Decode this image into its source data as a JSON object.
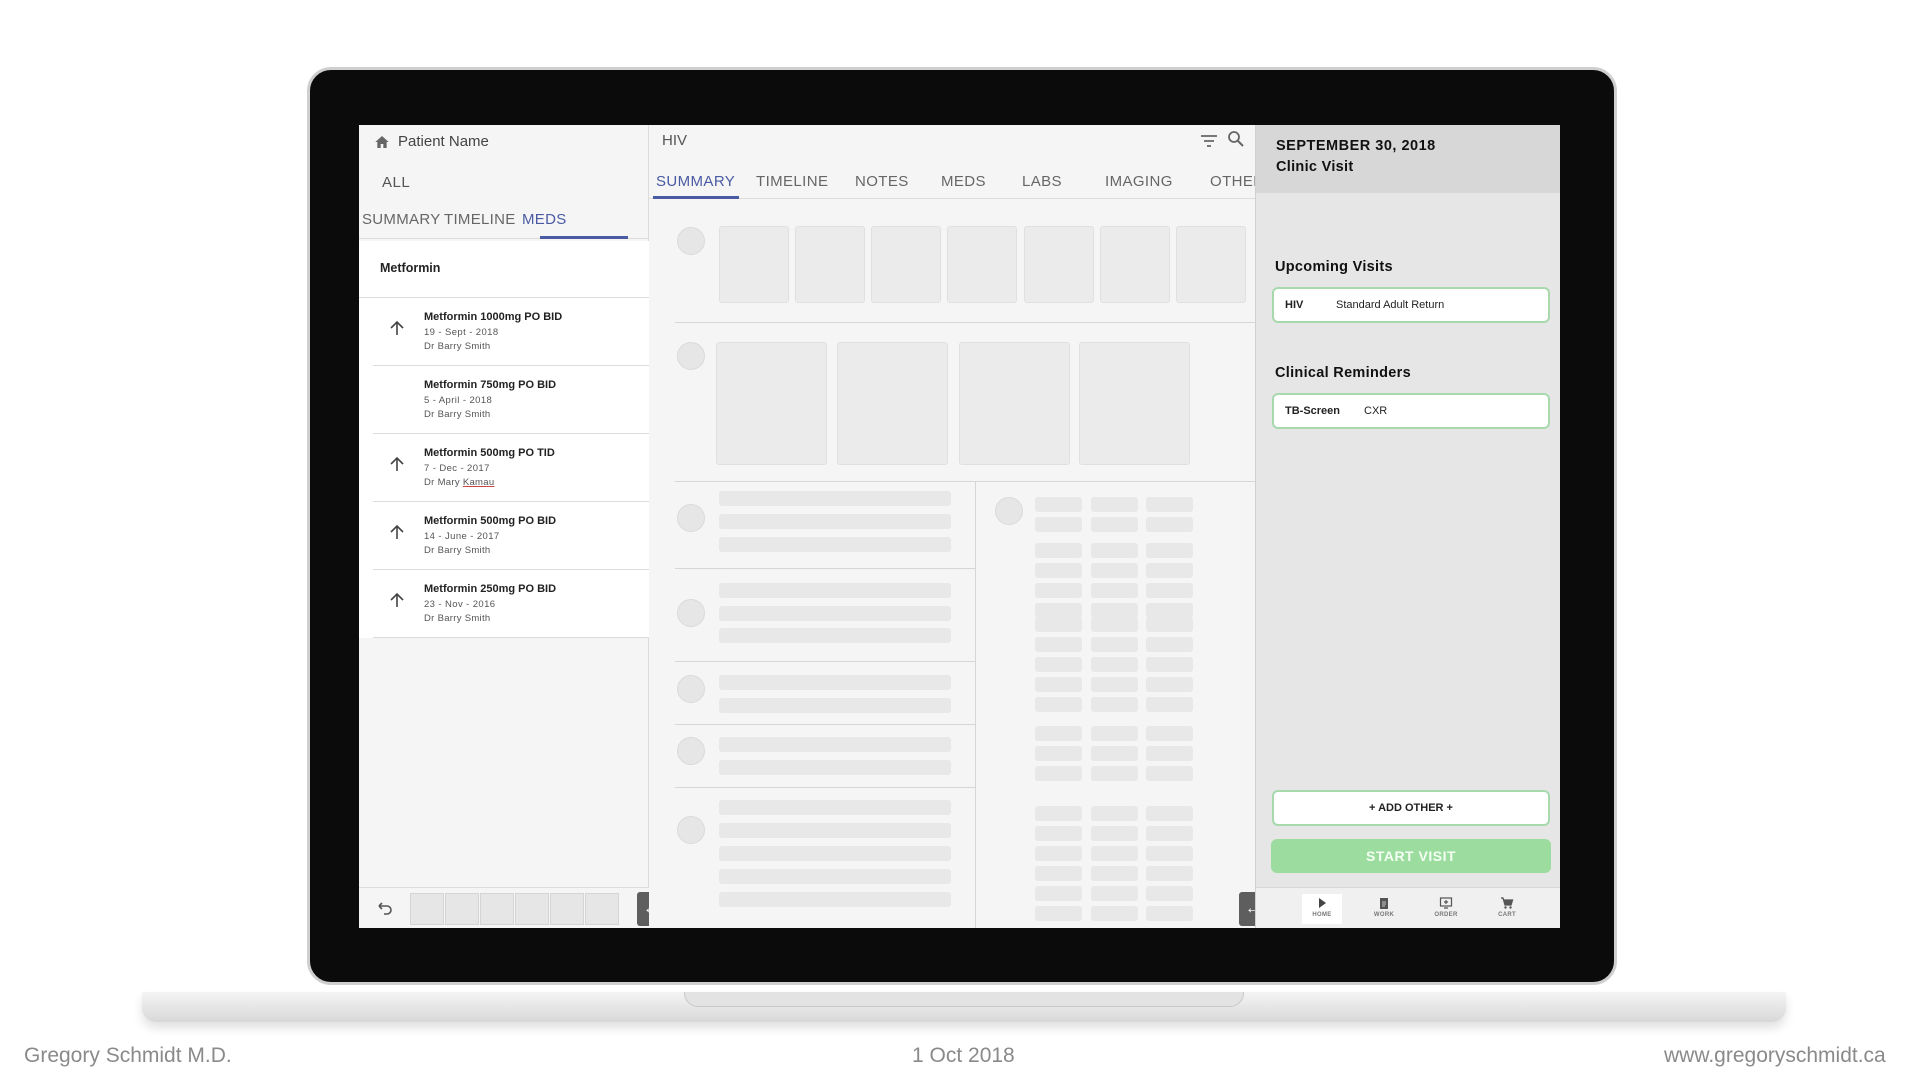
{
  "patient": {
    "name": "Patient Name",
    "filter": "ALL"
  },
  "left_tabs": [
    "SUMMARY",
    "TIMELINE",
    "MEDS"
  ],
  "med_group": "Metformin",
  "meds": [
    {
      "name": "Metformin 1000mg PO BID",
      "date": "19 - Sept - 2018",
      "doctor": "Dr Barry Smith",
      "arrow": true
    },
    {
      "name": "Metformin 750mg PO BID",
      "date": "5 - April - 2018",
      "doctor": "Dr Barry Smith",
      "arrow": false
    },
    {
      "name": "Metformin 500mg PO TID",
      "date": "7 - Dec - 2017",
      "doctor_prefix": "Dr Mary ",
      "doctor_surname": "Kamau",
      "arrow": true
    },
    {
      "name": "Metformin 500mg PO BID",
      "date": "14 - June - 2017",
      "doctor": "Dr Barry Smith",
      "arrow": true
    },
    {
      "name": "Metformin 250mg PO BID",
      "date": "23 - Nov - 2016",
      "doctor": "Dr Barry Smith",
      "arrow": true
    }
  ],
  "middle": {
    "title": "HIV",
    "tabs": [
      "SUMMARY",
      "TIMELINE",
      "NOTES",
      "MEDS",
      "LABS",
      "IMAGING",
      "OTHER"
    ]
  },
  "visit": {
    "date": "SEPTEMBER 30, 2018",
    "type": "Clinic Visit",
    "upcoming_title": "Upcoming Visits",
    "upcoming": {
      "tag": "HIV",
      "label": "Standard Adult Return"
    },
    "reminders_title": "Clinical Reminders",
    "reminder": {
      "tag": "TB-Screen",
      "label": "CXR"
    },
    "add_label": "+ ADD OTHER +",
    "start_label": "START VISIT"
  },
  "bottom_nav": [
    "HOME",
    "WORK",
    "ORDER",
    "CART"
  ],
  "colors": {
    "accent": "#4a5aa3",
    "green_border": "#a8d9ad",
    "start_button": "#9cdc9f"
  },
  "footer": {
    "author": "Gregory Schmidt M.D.",
    "date": "1 Oct 2018",
    "website": "www.gregoryschmidt.ca"
  }
}
